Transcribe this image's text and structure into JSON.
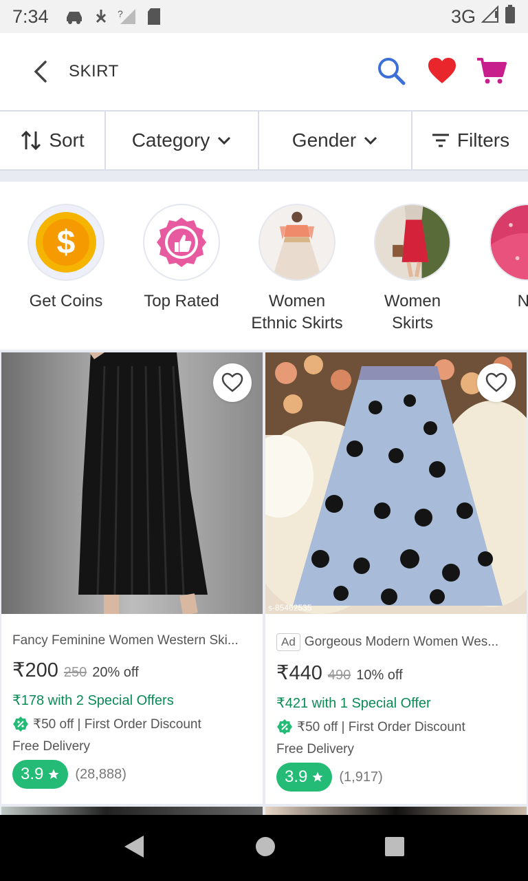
{
  "status": {
    "time": "7:34",
    "network": "3G"
  },
  "header": {
    "title": "SKIRT"
  },
  "filters": [
    {
      "label": "Sort"
    },
    {
      "label": "Category"
    },
    {
      "label": "Gender"
    },
    {
      "label": "Filters"
    }
  ],
  "categories": [
    {
      "label": "Get Coins"
    },
    {
      "label": "Top Rated"
    },
    {
      "label": "Women\nEthnic Skirts"
    },
    {
      "label": "Women\nSkirts"
    },
    {
      "label": "Ne"
    }
  ],
  "products": [
    {
      "name": "Fancy Feminine Women Western Ski...",
      "ad": "",
      "price": "₹200",
      "mrp": "250",
      "discount": "20% off",
      "special_offer": "₹178 with 2 Special Offers",
      "first_order": "₹50 off | First Order Discount",
      "delivery": "Free Delivery",
      "rating": "3.9",
      "rating_count": "(28,888)"
    },
    {
      "name": "Gorgeous Modern Women Wes...",
      "ad": "Ad",
      "sku": "s-85462535",
      "price": "₹440",
      "mrp": "490",
      "discount": "10% off",
      "special_offer": "₹421 with 1 Special Offer",
      "first_order": "₹50 off | First Order Discount",
      "delivery": "Free Delivery",
      "rating": "3.9",
      "rating_count": "(1,917)"
    }
  ],
  "colors": {
    "accent_green": "#23bb75",
    "heart_red": "#e8262b",
    "cart_magenta": "#c7208c",
    "search_blue": "#3d6fd8"
  }
}
